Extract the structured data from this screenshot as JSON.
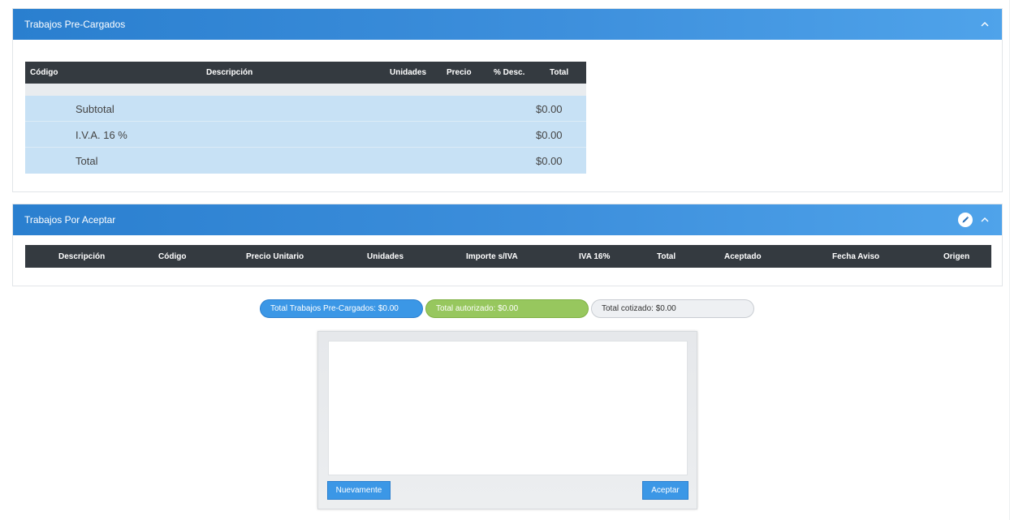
{
  "panel1": {
    "title": "Trabajos Pre-Cargados",
    "table": {
      "headers": [
        "Código",
        "Descripción",
        "Unidades",
        "Precio",
        "% Desc.",
        "Total"
      ],
      "summary": [
        {
          "label": "Subtotal",
          "value": "$0.00"
        },
        {
          "label": "I.V.A. 16 %",
          "value": "$0.00"
        },
        {
          "label": "Total",
          "value": "$0.00"
        }
      ]
    }
  },
  "panel2": {
    "title": "Trabajos Por Aceptar",
    "table": {
      "headers": [
        "Descripción",
        "Código",
        "Precio Unitario",
        "Unidades",
        "Importe s/IVA",
        "IVA 16%",
        "Total",
        "Aceptado",
        "Fecha Aviso",
        "Origen"
      ]
    }
  },
  "totals": {
    "precargados": "Total Trabajos Pre-Cargados: $0.00",
    "autorizado": "Total autorizado: $0.00",
    "cotizado": "Total cotizado: $0.00"
  },
  "signature": {
    "retry_label": "Nuevamente",
    "accept_label": "Aceptar"
  },
  "colors": {
    "header_start": "#2a7fcf",
    "header_end": "#4fa3ea",
    "table_head": "#343a40",
    "summary_row": "#c7e1f5",
    "pill_blue": "#3b97e6",
    "pill_green": "#97c75e"
  },
  "icons": {
    "collapse": "chevron-up-icon",
    "edit": "pencil-icon"
  }
}
